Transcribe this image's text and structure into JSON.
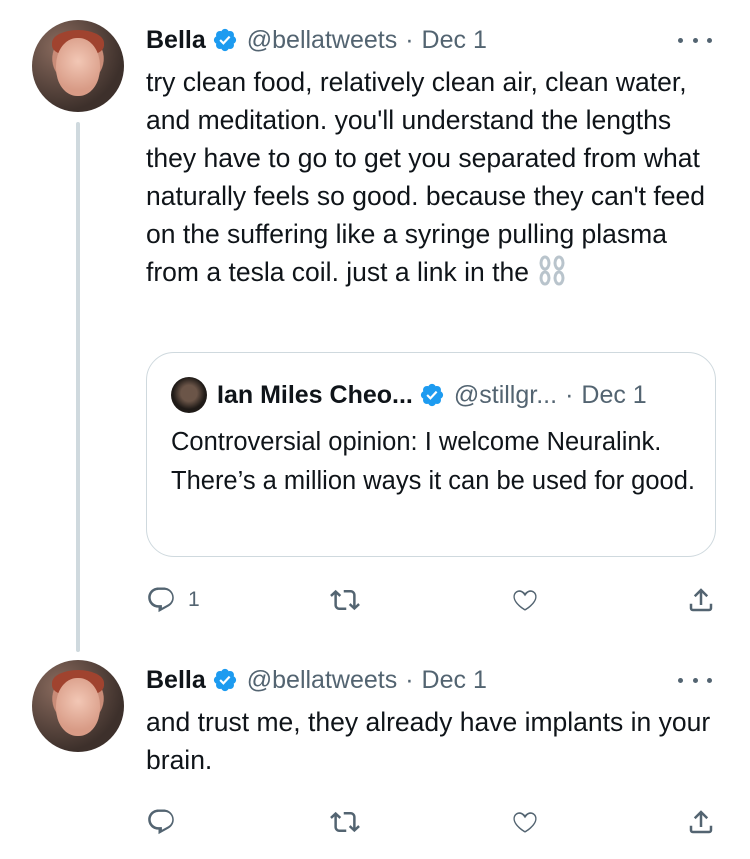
{
  "tweets": [
    {
      "author_name": "Bella",
      "handle": "@bellatweets",
      "separator": "·",
      "date": "Dec 1",
      "text": "try clean food, relatively clean air, clean water, and meditation. you'll understand the lengths they have to go to get you separated from what naturally feels so good. because they can't feed on the suffering like a syringe pulling plasma from a tesla coil. just a link in the",
      "emoji": "⛓",
      "quote": {
        "author_name": "Ian Miles Cheo...",
        "handle": "@stillgr...",
        "separator": "·",
        "date": "Dec 1",
        "text": "Controversial opinion: I welcome Neuralink. There’s a million ways it can be used for good."
      },
      "reply_count": "1"
    },
    {
      "author_name": "Bella",
      "handle": "@bellatweets",
      "separator": "·",
      "date": "Dec 1",
      "text": "and trust me, they already have implants in your brain."
    }
  ],
  "icons": {
    "verified": "verified-badge-icon",
    "more": "more-dots-icon",
    "reply": "reply-icon",
    "retweet": "retweet-icon",
    "like": "heart-icon",
    "share": "share-icon"
  },
  "colors": {
    "verified": "#1d9bf0",
    "secondary_text": "#536471",
    "border": "#cfd9de",
    "text": "#0f1419"
  }
}
